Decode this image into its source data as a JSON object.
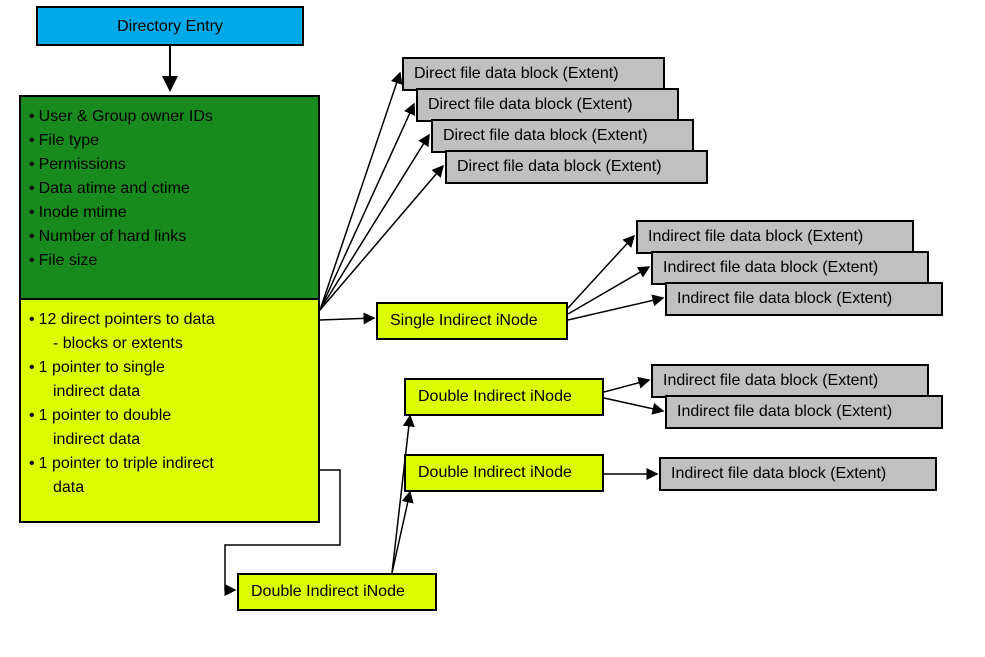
{
  "directoryEntry": {
    "label": "Directory Entry"
  },
  "inodeTop": {
    "items": [
      "User & Group owner IDs",
      "File type",
      "Permissions",
      "Data atime and ctime",
      "Inode mtime",
      "Number of hard links",
      "File size"
    ]
  },
  "inodeBottom": {
    "item1": "12 direct pointers to data",
    "item1sub": "- blocks or extents",
    "item2a": "1 pointer to single",
    "item2b": "indirect data",
    "item3a": "1 pointer to double",
    "item3b": "indirect data",
    "item4a": "1 pointer to triple indirect",
    "item4b": "data"
  },
  "directBlocks": {
    "b1": "Direct file data block (Extent)",
    "b2": "Direct file data block (Extent)",
    "b3": "Direct file data block (Extent)",
    "b4": "Direct file data block (Extent)"
  },
  "singleIndirect": {
    "label": "Single Indirect iNode"
  },
  "indirectBlocksA": {
    "b1": "Indirect file data block (Extent)",
    "b2": "Indirect file data block (Extent)",
    "b3": "Indirect file data block (Extent)"
  },
  "doubleIndirect1": {
    "label": "Double Indirect iNode"
  },
  "indirectBlocksB": {
    "b1": "Indirect file data block (Extent)",
    "b2": "Indirect file data block (Extent)"
  },
  "doubleIndirect2": {
    "label": "Double Indirect iNode"
  },
  "indirectBlocksC": {
    "b1": "Indirect file data block (Extent)"
  },
  "doubleIndirectBottom": {
    "label": "Double Indirect iNode"
  }
}
